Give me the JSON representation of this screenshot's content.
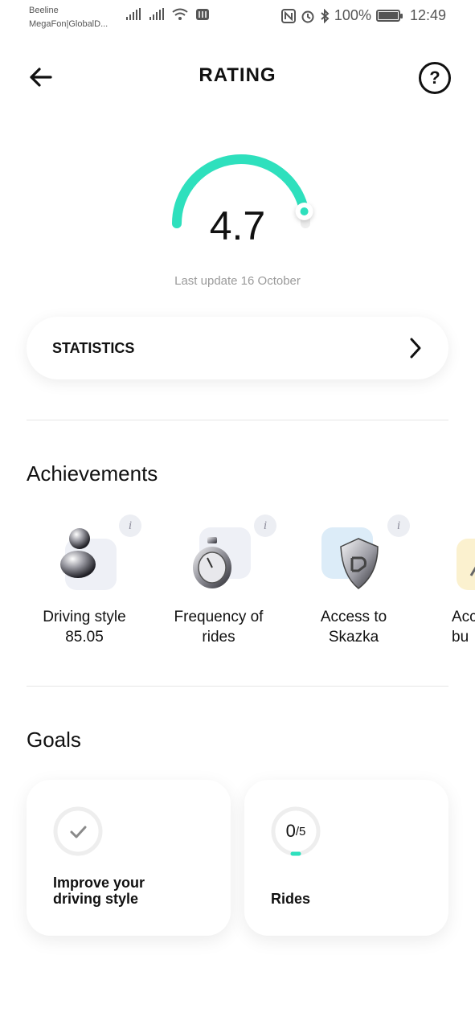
{
  "status_bar": {
    "carrier_1": "Beeline",
    "carrier_2": "MegaFon|GlobalD...",
    "battery": "100%",
    "time": "12:49"
  },
  "header": {
    "title": "RATING",
    "back_icon": "arrow-left-icon",
    "help_icon": "question-icon",
    "help_glyph": "?"
  },
  "rating": {
    "value": "4.7",
    "gauge_level": 0.94,
    "last_update": "Last update 16 October",
    "accent_color": "#2ee0bd"
  },
  "statistics": {
    "label": "STATISTICS",
    "chevron_icon": "chevron-right-icon"
  },
  "achievements": {
    "title": "Achievements",
    "items": [
      {
        "line1": "Driving style",
        "line2": "85.05",
        "icon": "person-figure-icon",
        "tile_color": "#eef0f6"
      },
      {
        "line1": "Frequency of",
        "line2": "rides",
        "icon": "stopwatch-icon",
        "tile_color": "#eef0f6"
      },
      {
        "line1": "Access to",
        "line2": "Skazka",
        "icon": "shield-icon",
        "tile_color": "#dcecf8"
      },
      {
        "line1": "Acc",
        "line2": "bu",
        "icon": "pen-icon",
        "tile_color": "#fbf1cf"
      }
    ],
    "info_glyph": "i"
  },
  "goals": {
    "title": "Goals",
    "items": [
      {
        "label_line1": "Improve your",
        "label_line2": "driving style",
        "icon": "check-icon"
      },
      {
        "label": "Rides",
        "count": "0",
        "total": "/5",
        "progress": 0
      }
    ]
  }
}
